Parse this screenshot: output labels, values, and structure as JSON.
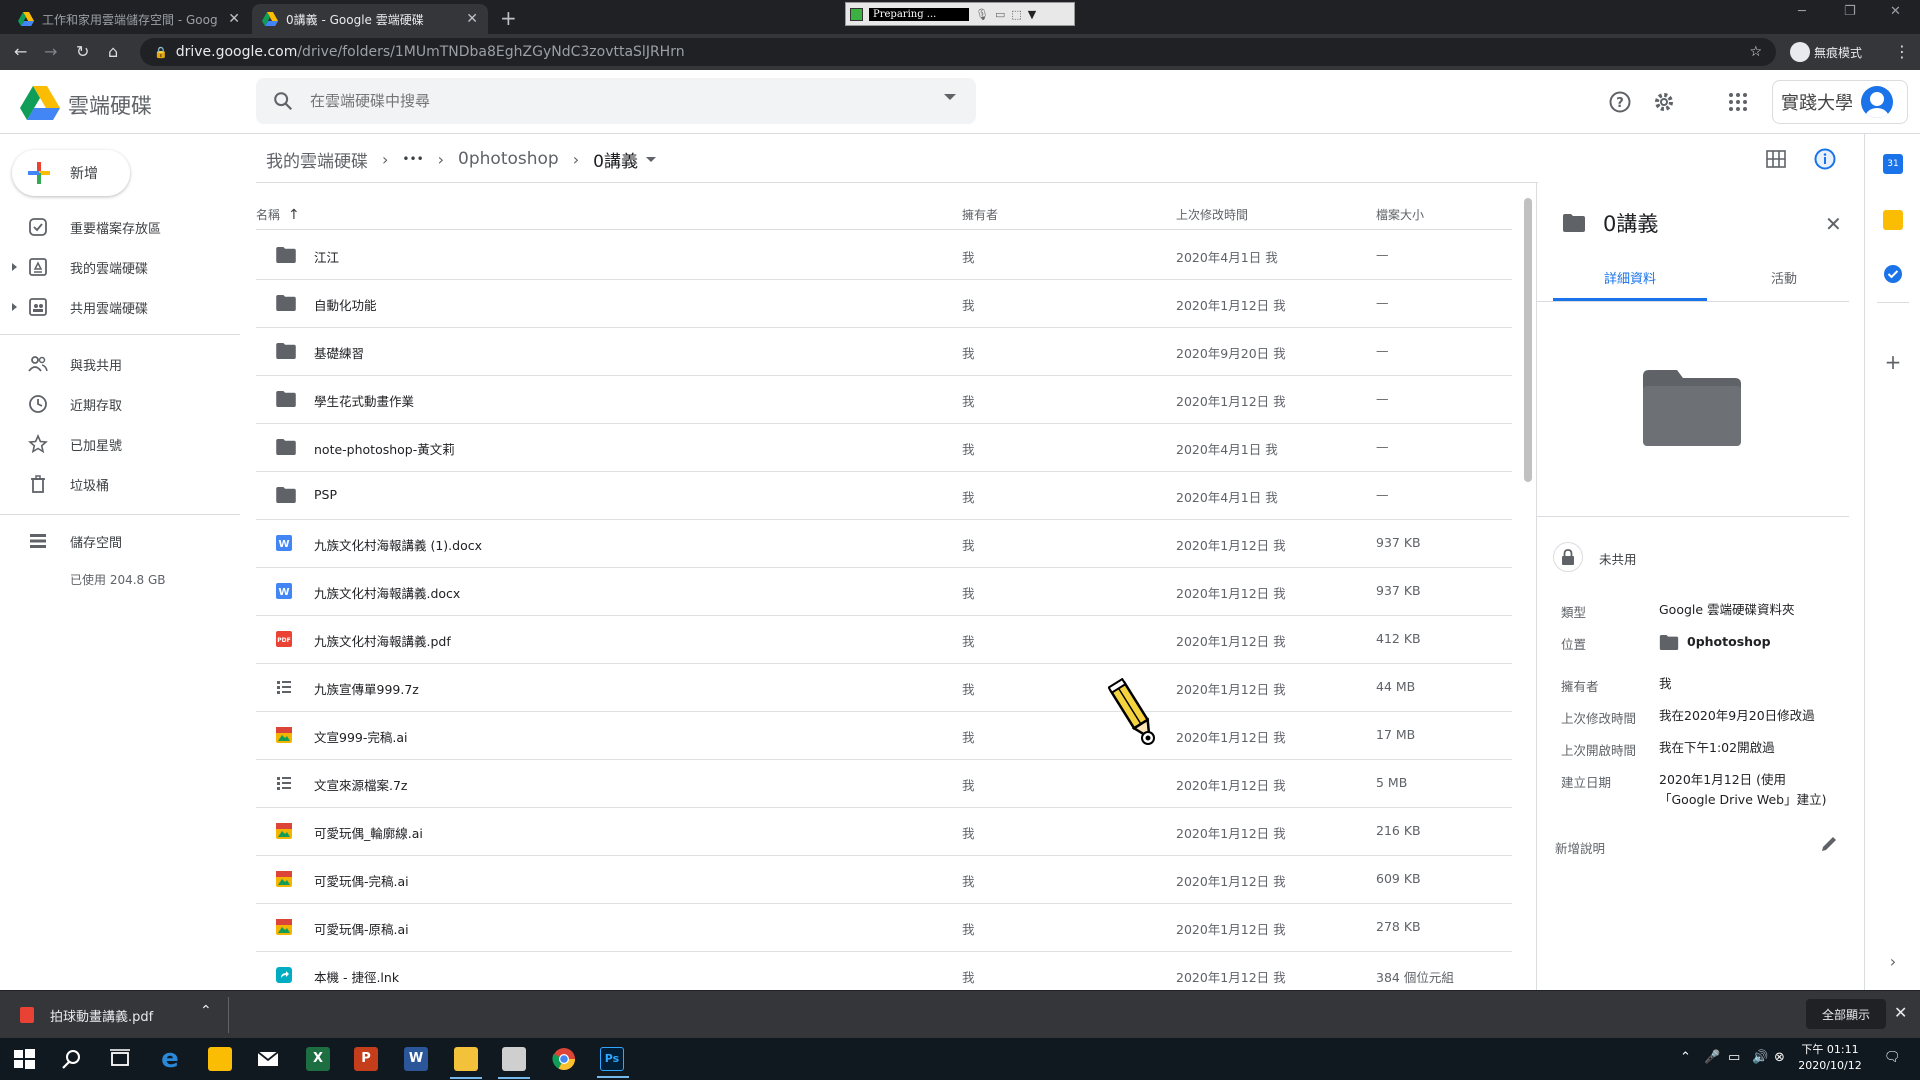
{
  "browser": {
    "tabs": [
      {
        "title": "工作和家用雲端儲存空間 - Goog",
        "active": false
      },
      {
        "title": "0講義 - Google 雲端硬碟",
        "active": true
      }
    ],
    "recorder_status": "Preparing ...",
    "url_host": "drive.google.com",
    "url_path": "/drive/folders/1MUmTNDba8EghZGyNdC3zovttaSlJRHrn",
    "incognito_label": "無痕模式"
  },
  "header": {
    "app_title": "雲端硬碟",
    "search_placeholder": "在雲端硬碟中搜尋",
    "org_name": "實踐大學"
  },
  "sidebar": {
    "new_label": "新增",
    "items": [
      {
        "label": "重要檔案存放區",
        "icon": "check-circle-icon"
      },
      {
        "label": "我的雲端硬碟",
        "icon": "my-drive-icon"
      },
      {
        "label": "共用雲端硬碟",
        "icon": "shared-drives-icon"
      },
      {
        "label": "與我共用",
        "icon": "people-icon"
      },
      {
        "label": "近期存取",
        "icon": "clock-icon"
      },
      {
        "label": "已加星號",
        "icon": "star-icon"
      },
      {
        "label": "垃圾桶",
        "icon": "trash-icon"
      },
      {
        "label": "儲存空間",
        "icon": "storage-icon"
      }
    ],
    "storage_used": "已使用 204.8 GB"
  },
  "breadcrumb": {
    "root": "我的雲端硬碟",
    "ellipsis": "•••",
    "parent": "0photoshop",
    "current": "0講義"
  },
  "list": {
    "columns": {
      "name": "名稱",
      "owner": "擁有者",
      "modified": "上次修改時間",
      "size": "檔案大小"
    },
    "sort_arrow": "↑",
    "rows": [
      {
        "name": "江江",
        "type": "folder",
        "owner": "我",
        "modified": "2020年4月1日 我",
        "size": "—"
      },
      {
        "name": "自動化功能",
        "type": "folder",
        "owner": "我",
        "modified": "2020年1月12日 我",
        "size": "—"
      },
      {
        "name": "基礎練習",
        "type": "folder",
        "owner": "我",
        "modified": "2020年9月20日 我",
        "size": "—"
      },
      {
        "name": "學生花式動畫作業",
        "type": "folder",
        "owner": "我",
        "modified": "2020年1月12日 我",
        "size": "—"
      },
      {
        "name": "note-photoshop-黃文莉",
        "type": "folder",
        "owner": "我",
        "modified": "2020年4月1日 我",
        "size": "—"
      },
      {
        "name": "PSP",
        "type": "folder",
        "owner": "我",
        "modified": "2020年4月1日 我",
        "size": "—"
      },
      {
        "name": "九族文化村海報講義 (1).docx",
        "type": "word",
        "owner": "我",
        "modified": "2020年1月12日 我",
        "size": "937 KB"
      },
      {
        "name": "九族文化村海報講義.docx",
        "type": "word",
        "owner": "我",
        "modified": "2020年1月12日 我",
        "size": "937 KB"
      },
      {
        "name": "九族文化村海報講義.pdf",
        "type": "pdf",
        "owner": "我",
        "modified": "2020年1月12日 我",
        "size": "412 KB"
      },
      {
        "name": "九族宣傳單999.7z",
        "type": "archive",
        "owner": "我",
        "modified": "2020年1月12日 我",
        "size": "44 MB"
      },
      {
        "name": "文宣999-完稿.ai",
        "type": "image",
        "owner": "我",
        "modified": "2020年1月12日 我",
        "size": "17 MB"
      },
      {
        "name": "文宣來源檔案.7z",
        "type": "archive",
        "owner": "我",
        "modified": "2020年1月12日 我",
        "size": "5 MB"
      },
      {
        "name": "可愛玩偶_輪廓線.ai",
        "type": "image",
        "owner": "我",
        "modified": "2020年1月12日 我",
        "size": "216 KB"
      },
      {
        "name": "可愛玩偶-完稿.ai",
        "type": "image",
        "owner": "我",
        "modified": "2020年1月12日 我",
        "size": "609 KB"
      },
      {
        "name": "可愛玩偶-原稿.ai",
        "type": "image",
        "owner": "我",
        "modified": "2020年1月12日 我",
        "size": "278 KB"
      },
      {
        "name": "本機 - 捷徑.lnk",
        "type": "shortcut",
        "owner": "我",
        "modified": "2020年1月12日 我",
        "size": "384 個位元組"
      }
    ]
  },
  "details": {
    "title": "0講義",
    "tab_details": "詳細資料",
    "tab_activity": "活動",
    "sharing": "未共用",
    "props": [
      {
        "k": "類型",
        "v": "Google 雲端硬碟資料夾"
      },
      {
        "k": "位置",
        "v": "0photoshop"
      },
      {
        "k": "擁有者",
        "v": "我"
      },
      {
        "k": "上次修改時間",
        "v": "我在2020年9月20日修改過"
      },
      {
        "k": "上次開啟時間",
        "v": "我在下午1:02開啟過"
      },
      {
        "k": "建立日期",
        "v": "2020年1月12日 (使用「Google Drive Web」建立)"
      }
    ],
    "add_description": "新增說明"
  },
  "downloads": {
    "file": "拍球動畫講義.pdf",
    "show_all": "全部顯示"
  },
  "taskbar": {
    "time": "下午 01:11",
    "date": "2020/10/12"
  },
  "colors": {
    "accent": "#1a73e8",
    "folder": "#5f6368",
    "word": "#4285f4",
    "pdf": "#ea4335"
  }
}
